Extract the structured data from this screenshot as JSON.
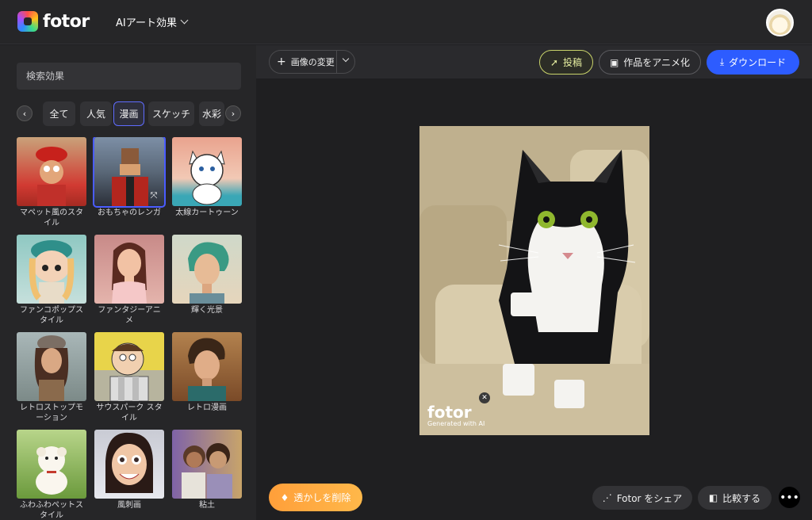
{
  "app": {
    "name": "fotor",
    "menu": "AIアート効果"
  },
  "sidebar": {
    "search_placeholder": "検索効果",
    "categories": [
      "全て",
      "人気",
      "漫画",
      "スケッチ",
      "水彩"
    ],
    "active_category": "漫画",
    "effects": [
      {
        "label": "マペット風のスタイル"
      },
      {
        "label": "おもちゃのレンガ"
      },
      {
        "label": "太線カートゥーン"
      },
      {
        "label": "ファンコポップスタイル"
      },
      {
        "label": "ファンタジーアニメ"
      },
      {
        "label": "輝く光景"
      },
      {
        "label": "レトロストップモーション"
      },
      {
        "label": "サウスパーク スタイル"
      },
      {
        "label": "レトロ漫画"
      },
      {
        "label": "ふわふわペットスタイル"
      },
      {
        "label": "風刺画"
      },
      {
        "label": "粘土"
      }
    ]
  },
  "toolbar": {
    "image_change": "画像の変更",
    "post": "投稿",
    "animate": "作品をアニメ化",
    "download": "ダウンロード"
  },
  "canvas": {
    "watermark_logo": "fotor",
    "watermark_sub": "Generated with AI",
    "remove_watermark": "透かしを削除",
    "share": "Fotor をシェア",
    "compare": "比較する"
  },
  "colors": {
    "accent": "#2d5cff",
    "orange": "#ffa23d",
    "bg": "#1f1f21",
    "panel": "#262628"
  }
}
